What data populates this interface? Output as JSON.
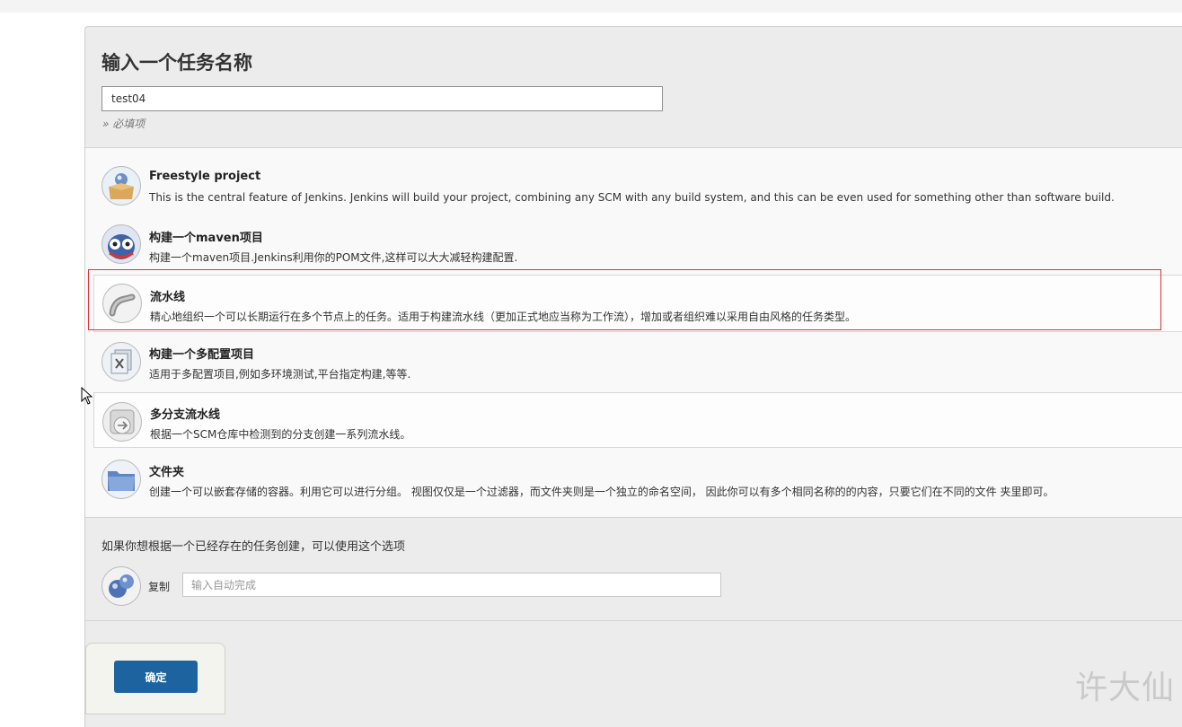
{
  "form": {
    "title": "输入一个任务名称",
    "name_value": "test04",
    "required_note": "» 必填项"
  },
  "job_types": [
    {
      "title": "Freestyle project",
      "description": "This is the central feature of Jenkins. Jenkins will build your project, combining any SCM with any build system, and this can be even used for something other than software build.",
      "icon": "freestyle-box-icon"
    },
    {
      "title": "构建一个maven项目",
      "description": "构建一个maven项目.Jenkins利用你的POM文件,这样可以大大减轻构建配置.",
      "icon": "maven-owl-icon"
    },
    {
      "title": "流水线",
      "description": "精心地组织一个可以长期运行在多个节点上的任务。适用于构建流水线（更加正式地应当称为工作流），增加或者组织难以采用自由风格的任务类型。",
      "icon": "pipeline-icon"
    },
    {
      "title": "构建一个多配置项目",
      "description": "适用于多配置项目,例如多环境测试,平台指定构建,等等.",
      "icon": "multi-config-icon"
    },
    {
      "title": "多分支流水线",
      "description": "根据一个SCM仓库中检测到的分支创建一系列流水线。",
      "icon": "multibranch-icon"
    },
    {
      "title": "文件夹",
      "description": "创建一个可以嵌套存储的容器。利用它可以进行分组。 视图仅仅是一个过滤器，而文件夹则是一个独立的命名空间， 因此你可以有多个相同名称的的内容，只要它们在不同的文件 夹里即可。",
      "icon": "folder-icon"
    }
  ],
  "copy": {
    "hint": "如果你想根据一个已经存在的任务创建，可以使用这个选项",
    "label": "复制",
    "placeholder": "输入自动完成"
  },
  "ok_label": "确定",
  "watermark": "许大仙",
  "colors": {
    "primary_button": "#1d63a0",
    "highlight_border": "#e0303a"
  }
}
